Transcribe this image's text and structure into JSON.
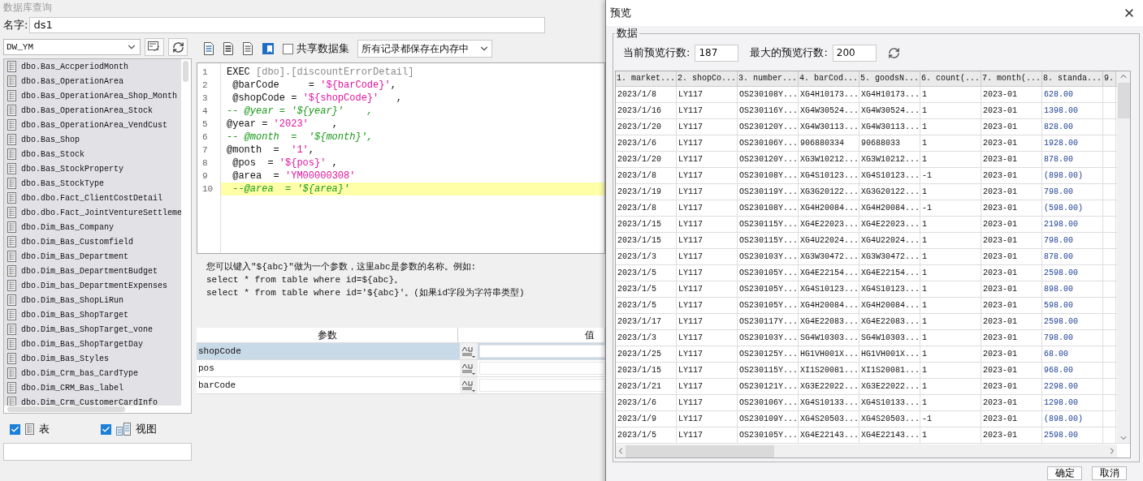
{
  "window": {
    "title": "数据库查询"
  },
  "name_field": {
    "label": "名字:",
    "value": "ds1"
  },
  "connection": {
    "value": "DW_YM"
  },
  "tables": [
    {
      "label": "dbo.Bas_AccperiodMonth"
    },
    {
      "label": "dbo.Bas_OperationArea"
    },
    {
      "label": "dbo.Bas_OperationArea_Shop_Month"
    },
    {
      "label": "dbo.Bas_OperationArea_Stock"
    },
    {
      "label": "dbo.Bas_OperationArea_VendCust"
    },
    {
      "label": "dbo.Bas_Shop"
    },
    {
      "label": "dbo.Bas_Stock"
    },
    {
      "label": "dbo.Bas_StockProperty"
    },
    {
      "label": "dbo.Bas_StockType"
    },
    {
      "label": "dbo.dbo.Fact_ClientCostDetail"
    },
    {
      "label": "dbo.dbo.Fact_JointVentureSettleme"
    },
    {
      "label": "dbo.Dim_Bas_Company"
    },
    {
      "label": "dbo.Dim_Bas_Customfield"
    },
    {
      "label": "dbo.Dim_Bas_Department"
    },
    {
      "label": "dbo.Dim_Bas_DepartmentBudget"
    },
    {
      "label": "dbo.Dim_bas_DepartmentExpenses"
    },
    {
      "label": "dbo.Dim_Bas_ShopLiRun"
    },
    {
      "label": "dbo.Dim_Bas_ShopTarget"
    },
    {
      "label": "dbo.Dim_Bas_ShopTarget_vone"
    },
    {
      "label": "dbo.Dim_Bas_ShopTargetDay"
    },
    {
      "label": "dbo.Dim_Bas_Styles"
    },
    {
      "label": "dbo.Dim_Crm_bas_CardType"
    },
    {
      "label": "dbo.Dim_CRM_Bas_label"
    },
    {
      "label": "dbo.Dim_Crm_CustomerCardInfo"
    }
  ],
  "filters": [
    {
      "kind": "table",
      "label": "表",
      "checked": true
    },
    {
      "kind": "view",
      "label": "视图",
      "checked": true
    }
  ],
  "toolbar": {
    "share": {
      "label": "共享数据集",
      "checked": false
    },
    "mode": {
      "value": "所有记录都保存在内存中"
    }
  },
  "editor": {
    "lines": [
      {
        "number": "1",
        "highlighted": false,
        "tokens": [
          {
            "kind": "keyword",
            "text": "EXEC "
          },
          {
            "kind": "bracket",
            "text": "[dbo].[discountErrorDetail]"
          }
        ]
      },
      {
        "number": "2",
        "highlighted": false,
        "tokens": [
          {
            "kind": "plain",
            "text": " @barCode     = "
          },
          {
            "kind": "string",
            "text": "'${barCode}'"
          },
          {
            "kind": "plain",
            "text": ","
          }
        ]
      },
      {
        "number": "3",
        "highlighted": false,
        "tokens": [
          {
            "kind": "plain",
            "text": " @shopCode = "
          },
          {
            "kind": "string",
            "text": "'${shopCode}'"
          },
          {
            "kind": "plain",
            "text": "   ,"
          }
        ]
      },
      {
        "number": "4",
        "highlighted": false,
        "tokens": [
          {
            "kind": "comment",
            "text": "-- @year = '${year}'    ,"
          }
        ]
      },
      {
        "number": "5",
        "highlighted": false,
        "tokens": [
          {
            "kind": "plain",
            "text": "@year = "
          },
          {
            "kind": "string",
            "text": "'2023'"
          },
          {
            "kind": "plain",
            "text": "    ,"
          }
        ]
      },
      {
        "number": "6",
        "highlighted": false,
        "tokens": [
          {
            "kind": "comment",
            "text": "-- @month  =  '${month}',"
          }
        ]
      },
      {
        "number": "7",
        "highlighted": false,
        "tokens": [
          {
            "kind": "plain",
            "text": "@month  =  "
          },
          {
            "kind": "string",
            "text": "'1'"
          },
          {
            "kind": "plain",
            "text": ","
          }
        ]
      },
      {
        "number": "8",
        "highlighted": false,
        "tokens": [
          {
            "kind": "plain",
            "text": " @pos  = "
          },
          {
            "kind": "string",
            "text": "'${pos}'"
          },
          {
            "kind": "plain",
            "text": " ,"
          }
        ]
      },
      {
        "number": "9",
        "highlighted": false,
        "tokens": [
          {
            "kind": "plain",
            "text": " @area  = "
          },
          {
            "kind": "string",
            "text": "'YM00000308'"
          }
        ]
      },
      {
        "number": "10",
        "highlighted": true,
        "tokens": [
          {
            "kind": "comment",
            "text": " --@area  = '${area}'"
          }
        ]
      }
    ]
  },
  "hint": [
    "您可以键入\"${abc}\"做为一个参数，这里abc是参数的名称。例如:",
    "select * from table where id=${abc}。",
    "select * from table where id='${abc}'。(如果id字段为字符串类型)"
  ],
  "parameters": {
    "columns": [
      "参数",
      "值"
    ],
    "rows": [
      {
        "name": "shopCode",
        "selected": true
      },
      {
        "name": "pos",
        "selected": false
      },
      {
        "name": "barCode",
        "selected": false
      }
    ]
  },
  "preview": {
    "title": "预览",
    "group": "数据",
    "current_label": "当前预览行数:",
    "current_value": "187",
    "max_label": "最大的预览行数:",
    "max_value": "200",
    "columns": [
      "1. market...",
      "2. shopCo...",
      "3. number...",
      "4. barCod...",
      "5. goodsN...",
      "6. count(...",
      "7. month(...",
      "8. standa...",
      "9."
    ],
    "rows": [
      [
        "2023/1/8",
        "LY117",
        "OS230108Y...",
        "XG4H10173...",
        "XG4H10173...",
        "1",
        "2023-01",
        "628.00"
      ],
      [
        "2023/1/16",
        "LY117",
        "OS230116Y...",
        "XG4W30524...",
        "XG4W30524...",
        "1",
        "2023-01",
        "1398.00"
      ],
      [
        "2023/1/20",
        "LY117",
        "OS230120Y...",
        "XG4W30113...",
        "XG4W30113...",
        "1",
        "2023-01",
        "828.00"
      ],
      [
        "2023/1/6",
        "LY117",
        "OS230106Y...",
        "906880334",
        "90688033",
        "1",
        "2023-01",
        "1928.00"
      ],
      [
        "2023/1/20",
        "LY117",
        "OS230120Y...",
        "XG3W10212...",
        "XG3W10212...",
        "1",
        "2023-01",
        "878.00"
      ],
      [
        "2023/1/8",
        "LY117",
        "OS230108Y...",
        "XG4S10123...",
        "XG4S10123...",
        "-1",
        "2023-01",
        "(898.00)"
      ],
      [
        "2023/1/19",
        "LY117",
        "OS230119Y...",
        "XG3G20122...",
        "XG3G20122...",
        "1",
        "2023-01",
        "798.00"
      ],
      [
        "2023/1/8",
        "LY117",
        "OS230108Y...",
        "XG4H20084...",
        "XG4H20084...",
        "-1",
        "2023-01",
        "(598.00)"
      ],
      [
        "2023/1/15",
        "LY117",
        "OS230115Y...",
        "XG4E22023...",
        "XG4E22023...",
        "1",
        "2023-01",
        "2198.00"
      ],
      [
        "2023/1/15",
        "LY117",
        "OS230115Y...",
        "XG4U22024...",
        "XG4U22024...",
        "1",
        "2023-01",
        "798.00"
      ],
      [
        "2023/1/3",
        "LY117",
        "OS230103Y...",
        "XG3W30472...",
        "XG3W30472...",
        "1",
        "2023-01",
        "878.00"
      ],
      [
        "2023/1/5",
        "LY117",
        "OS230105Y...",
        "XG4E22154...",
        "XG4E22154...",
        "1",
        "2023-01",
        "2598.00"
      ],
      [
        "2023/1/5",
        "LY117",
        "OS230105Y...",
        "XG4S10123...",
        "XG4S10123...",
        "1",
        "2023-01",
        "898.00"
      ],
      [
        "2023/1/5",
        "LY117",
        "OS230105Y...",
        "XG4H20084...",
        "XG4H20084...",
        "1",
        "2023-01",
        "598.00"
      ],
      [
        "2023/1/17",
        "LY117",
        "OS230117Y...",
        "XG4E22083...",
        "XG4E22083...",
        "1",
        "2023-01",
        "2598.00"
      ],
      [
        "2023/1/3",
        "LY117",
        "OS230103Y...",
        "SG4W10303...",
        "SG4W10303...",
        "1",
        "2023-01",
        "798.00"
      ],
      [
        "2023/1/25",
        "LY117",
        "OS230125Y...",
        "HG1VH001X...",
        "HG1VH001X...",
        "1",
        "2023-01",
        "68.00"
      ],
      [
        "2023/1/15",
        "LY117",
        "OS230115Y...",
        "XI1S20081...",
        "XI1S20081...",
        "1",
        "2023-01",
        "968.00"
      ],
      [
        "2023/1/21",
        "LY117",
        "OS230121Y...",
        "XG3E22022...",
        "XG3E22022...",
        "1",
        "2023-01",
        "2298.00"
      ],
      [
        "2023/1/6",
        "LY117",
        "OS230106Y...",
        "XG4S10133...",
        "XG4S10133...",
        "1",
        "2023-01",
        "1298.00"
      ],
      [
        "2023/1/9",
        "LY117",
        "OS230109Y...",
        "XG4S20503...",
        "XG4S20503...",
        "-1",
        "2023-01",
        "(898.00)"
      ],
      [
        "2023/1/5",
        "LY117",
        "OS230105Y...",
        "XG4E22143...",
        "XG4E22143...",
        "1",
        "2023-01",
        "2598.00"
      ]
    ],
    "buttons": [
      "确定",
      "取消"
    ]
  }
}
